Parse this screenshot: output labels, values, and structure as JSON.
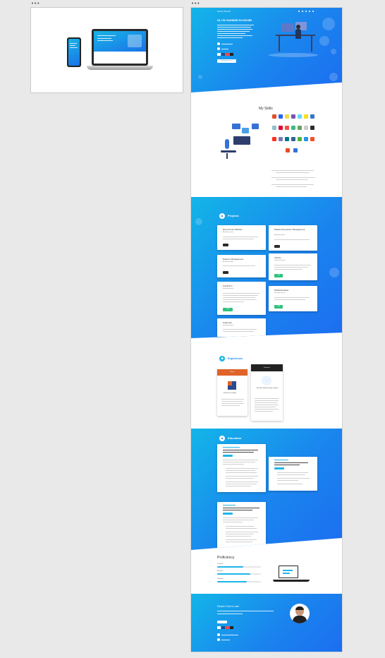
{
  "frames": {
    "left_handle": "•••",
    "right_handle": "•••"
  },
  "hero": {
    "logo": "Yassine Elhoubi",
    "nav_items": [
      "",
      "",
      "",
      "",
      ""
    ],
    "title": "HI, I'M YASSINE ELHOUBI",
    "cta": "Telecharger mon CV"
  },
  "skills": {
    "title": "My Skills"
  },
  "projects": {
    "title": "Projects",
    "items": [
      {
        "title": "Ecommerce Website",
        "subtitle": "Academic project",
        "button": ""
      },
      {
        "title": "Malaria Prevention Management",
        "subtitle": "Academic project",
        "button": ""
      },
      {
        "title": "Delivery Management",
        "subtitle": "Academic project",
        "button": ""
      },
      {
        "title": "Clinicty",
        "subtitle": "Freelance project",
        "button": "LIVE"
      },
      {
        "title": "FoodTILin",
        "subtitle": "Internship project",
        "button": "LIVE"
      },
      {
        "title": "Mobileboutique",
        "subtitle": "Internship project",
        "button": "LIVE"
      },
      {
        "title": "Snapmail",
        "subtitle": "Internship project",
        "button": ""
      }
    ]
  },
  "experience": {
    "title": "Experience",
    "cards": [
      {
        "header": "Stage 1",
        "role": "Full Stack Developer"
      },
      {
        "header": "Freelance",
        "role": "Full Stack Web Developer Student"
      }
    ]
  },
  "education": {
    "title": "Education"
  },
  "proficiency": {
    "title": "Proficiency",
    "bars": [
      {
        "label": "Frontend",
        "value": 0.6
      },
      {
        "label": "Backend",
        "value": 0.75
      },
      {
        "label": "Database",
        "value": 0.68
      }
    ]
  },
  "contact": {
    "title": "Reach Out to me!"
  },
  "colors": {
    "primary": "#1a85ee",
    "accent": "#13b5e8",
    "experience_header_1": "#e0632a",
    "experience_header_2": "#222222"
  }
}
